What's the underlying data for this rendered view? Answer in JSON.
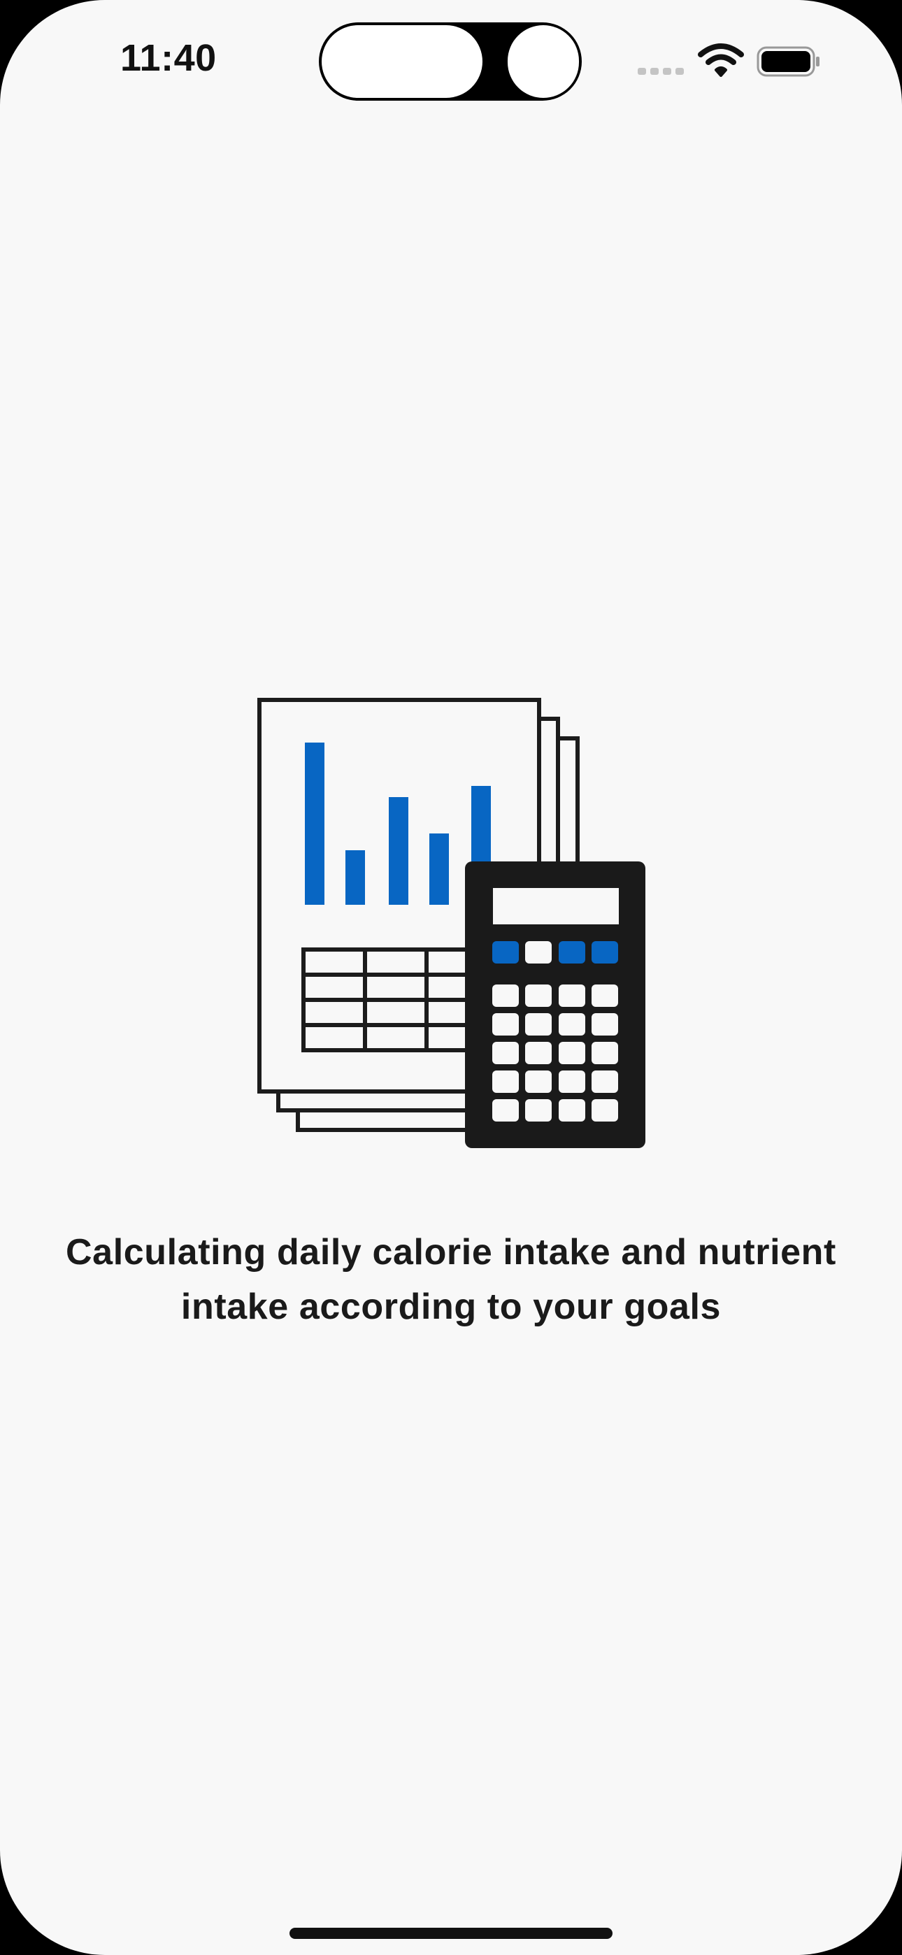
{
  "status_bar": {
    "time": "11:40",
    "icons": [
      "cellular-signal-icon",
      "wifi-icon",
      "battery-icon"
    ]
  },
  "illustration": {
    "icon": "report-and-calculator-icon",
    "accent_color": "#0866c3"
  },
  "loading": {
    "message": "Calculating daily calorie intake and nutrient intake according to your goals"
  }
}
